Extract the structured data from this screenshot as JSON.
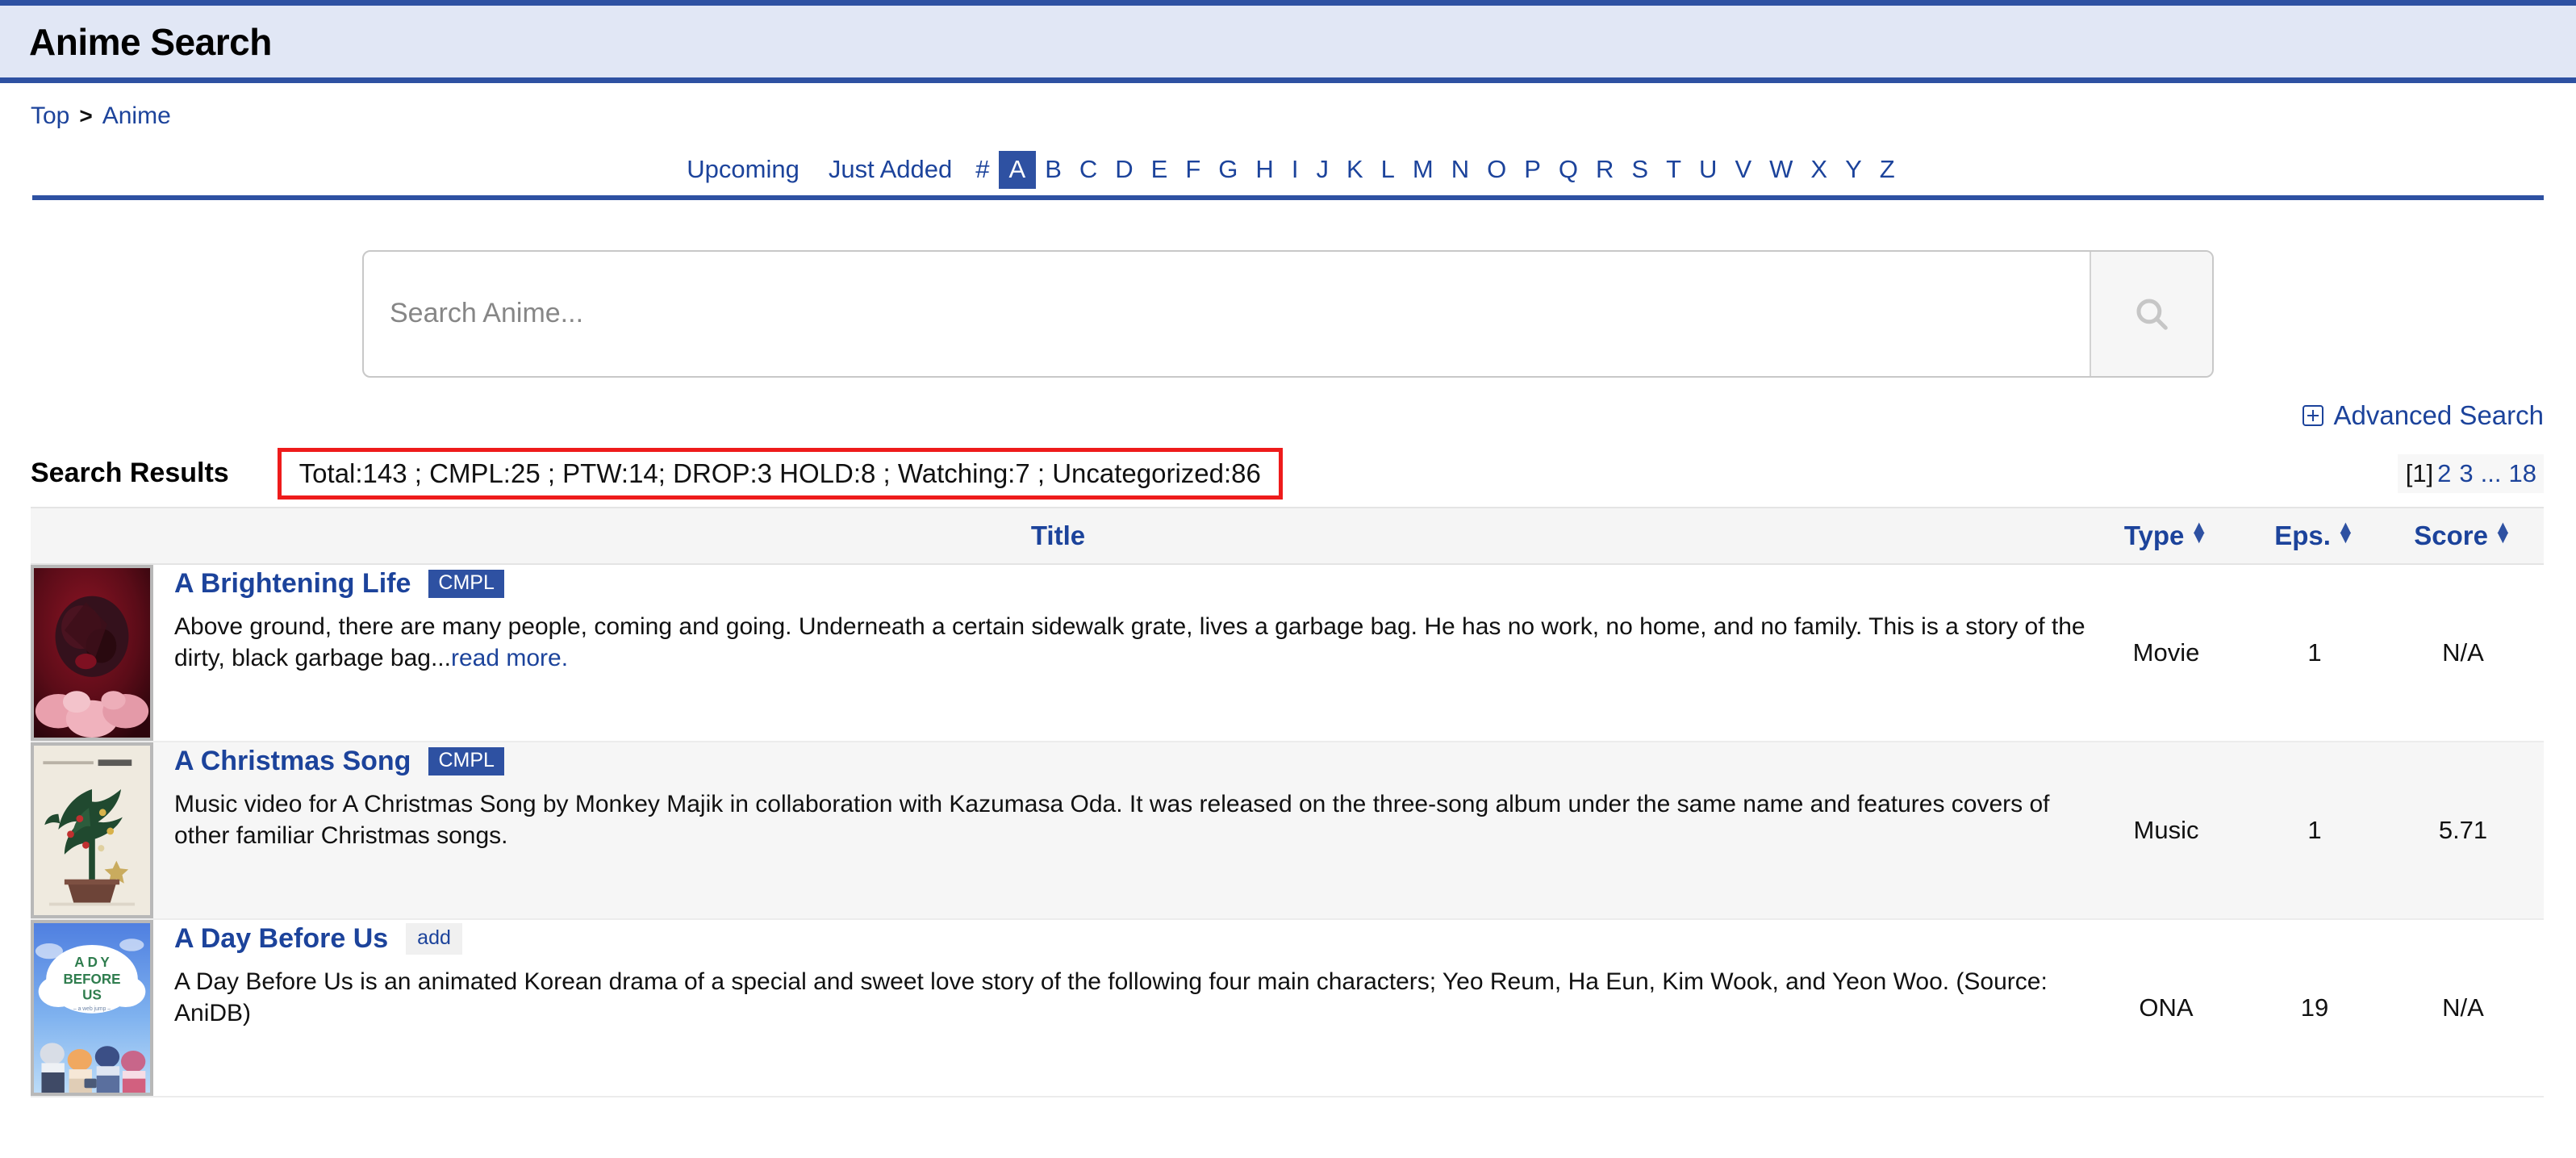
{
  "header": {
    "title": "Anime Search"
  },
  "breadcrumb": {
    "top": "Top",
    "separator": ">",
    "current": "Anime"
  },
  "alpha_nav": {
    "links": [
      "Upcoming",
      "Just Added",
      "#",
      "A",
      "B",
      "C",
      "D",
      "E",
      "F",
      "G",
      "H",
      "I",
      "J",
      "K",
      "L",
      "M",
      "N",
      "O",
      "P",
      "Q",
      "R",
      "S",
      "T",
      "U",
      "V",
      "W",
      "X",
      "Y",
      "Z"
    ],
    "active": "A"
  },
  "search": {
    "placeholder": "Search Anime...",
    "value": "",
    "icon": "search-icon"
  },
  "advanced_search": {
    "label": "Advanced Search",
    "icon": "plus-box-icon"
  },
  "results": {
    "heading": "Search Results",
    "stats": "Total:143 ; CMPL:25 ; PTW:14; DROP:3 HOLD:8 ; Watching:7 ; Uncategorized:86",
    "stats_highlight_color": "#ee1b1b"
  },
  "pagination": {
    "current": "[1]",
    "pages": [
      "2",
      "3"
    ],
    "ellipsis": "...",
    "last": "18"
  },
  "table": {
    "columns": {
      "title": "Title",
      "type": "Type",
      "eps": "Eps.",
      "score": "Score"
    },
    "rows": [
      {
        "title": "A Brightening Life",
        "badge": "CMPL",
        "badge_style": "status",
        "synopsis": "Above ground, there are many people, coming and going. Underneath a certain sidewalk grate, lives a garbage bag. He has no work, no home, and no family. This is a story of the dirty, black garbage bag...",
        "read_more": "read more.",
        "type": "Movie",
        "eps": "1",
        "score": "N/A"
      },
      {
        "title": "A Christmas Song",
        "badge": "CMPL",
        "badge_style": "status",
        "synopsis": "Music video for A Christmas Song by Monkey Majik in collaboration with Kazumasa Oda. It was released on the three-song album under the same name and features covers of other familiar Christmas songs.",
        "read_more": "",
        "type": "Music",
        "eps": "1",
        "score": "5.71"
      },
      {
        "title": "A Day Before Us",
        "badge": "add",
        "badge_style": "add",
        "synopsis": "A Day Before Us is an animated Korean drama of a special and sweet love story of the following four main characters; Yeo Reum, Ha Eun, Kim Wook, and Yeon Woo. (Source: AniDB)",
        "read_more": "",
        "type": "ONA",
        "eps": "19",
        "score": "N/A"
      }
    ]
  }
}
